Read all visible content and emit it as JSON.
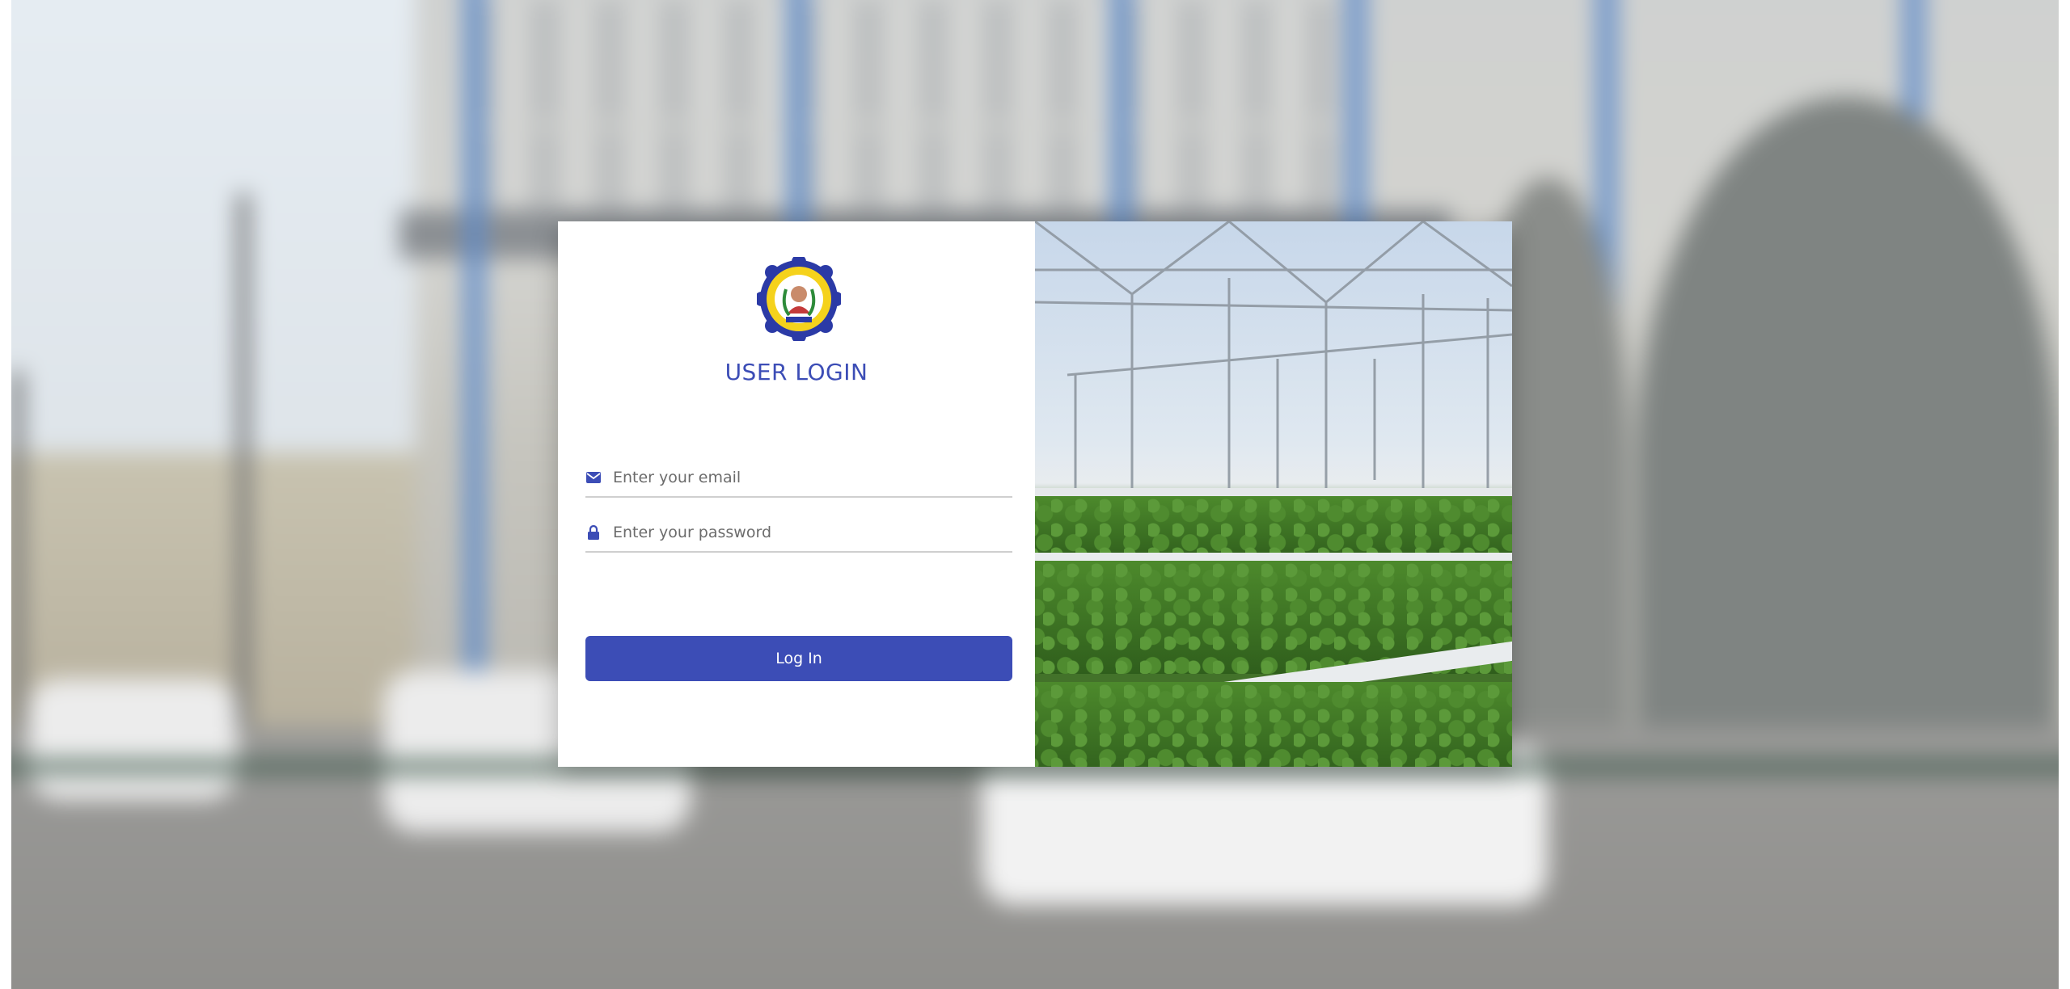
{
  "login": {
    "title": "USER LOGIN",
    "email_placeholder": "Enter your email",
    "password_placeholder": "Enter your password",
    "submit_label": "Log In"
  },
  "icons": {
    "email": "envelope-icon",
    "password": "lock-icon",
    "logo": "school-seal-logo"
  },
  "colors": {
    "accent": "#3c4db6",
    "field_border": "#cfcfcf",
    "card_bg": "#ffffff"
  }
}
